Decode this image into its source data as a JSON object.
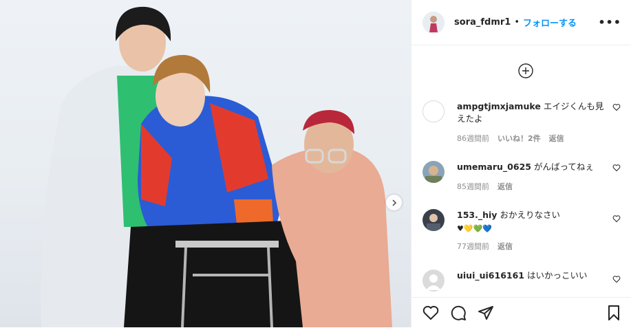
{
  "header": {
    "username": "sora_fdmr1",
    "separator": "•",
    "follow_label": "フォローする",
    "more_icon": "more-horizontal-icon"
  },
  "comments": [
    {
      "username": "ampgtjmxjamuke",
      "text": "エイジくんも見えたよ",
      "time": "86週間前",
      "likes": "いいね！2件",
      "reply": "返信"
    },
    {
      "username": "umemaru_0625",
      "text": "がんばってねぇ",
      "time": "85週間前",
      "reply": "返信"
    },
    {
      "username": "153._hiy",
      "text": "おかえりなさい",
      "emoji": "♥💛💚💙",
      "time": "77週間前",
      "reply": "返信"
    },
    {
      "username": "uiui_ui616161",
      "text": "はいかっこいい"
    }
  ],
  "colors": {
    "accent": "#0095f6",
    "text": "#262626",
    "secondary": "#8e8e8e",
    "border": "#efefef"
  },
  "icons": {
    "load_more": "plus-circle-icon",
    "like": "heart-icon",
    "comment": "comment-bubble-icon",
    "share": "paper-plane-icon",
    "save": "bookmark-icon",
    "next": "chevron-right-icon"
  }
}
